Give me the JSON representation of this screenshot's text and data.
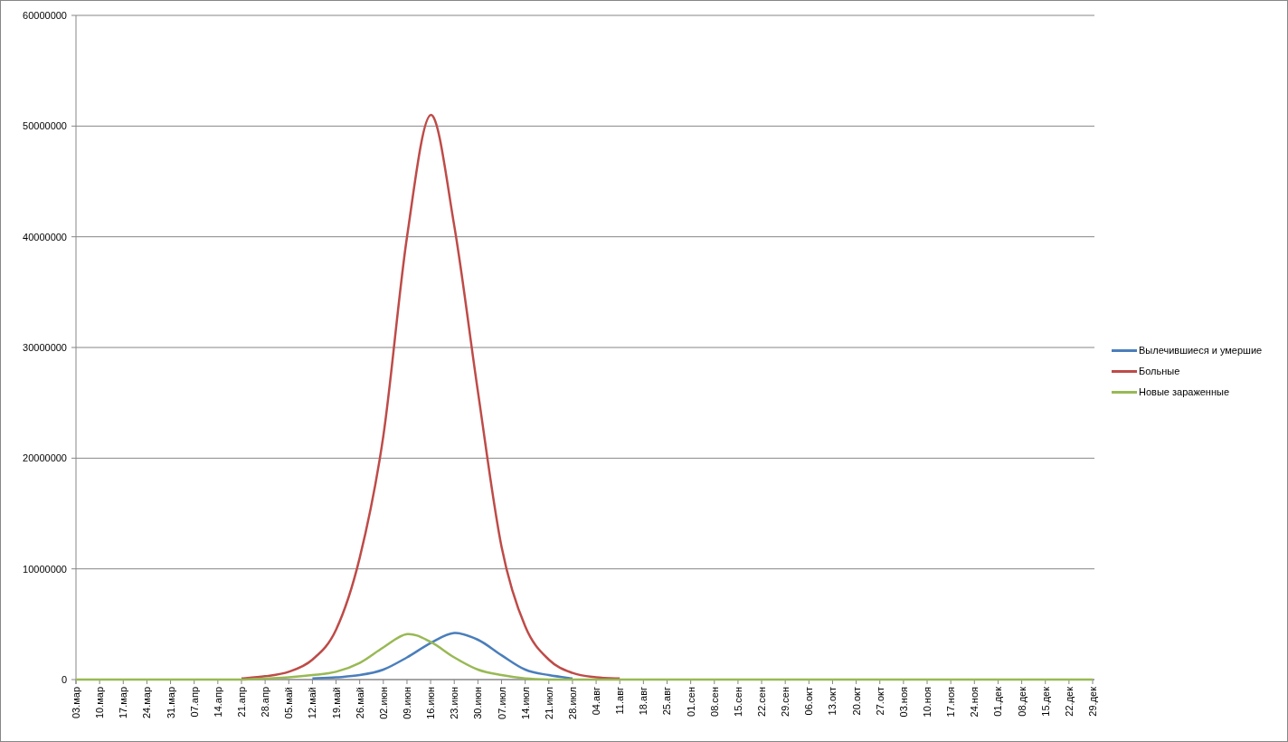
{
  "chart_data": {
    "type": "line",
    "grid": true,
    "categories": [
      "03.мар",
      "10.мар",
      "17.мар",
      "24.мар",
      "31.мар",
      "07.апр",
      "14.апр",
      "21.апр",
      "28.апр",
      "05.май",
      "12.май",
      "19.май",
      "26.май",
      "02.июн",
      "09.июн",
      "16.июн",
      "23.июн",
      "30.июн",
      "07.июл",
      "14.июл",
      "21.июл",
      "28.июл",
      "04.авг",
      "11.авг",
      "18.авг",
      "25.авг",
      "01.сен",
      "08.сен",
      "15.сен",
      "22.сен",
      "29.сен",
      "06.окт",
      "13.окт",
      "20.окт",
      "27.окт",
      "03.ноя",
      "10.ноя",
      "17.ноя",
      "24.ноя",
      "01.дек",
      "08.дек",
      "15.дек",
      "22.дек",
      "29.дек"
    ],
    "ylim": [
      0,
      60000000
    ],
    "yticks": [
      0,
      10000000,
      20000000,
      30000000,
      40000000,
      50000000,
      60000000
    ],
    "series": [
      {
        "name": "Вылечившиеся и умершие",
        "color": "#4a7ebb",
        "values": [
          null,
          null,
          null,
          null,
          null,
          null,
          null,
          null,
          null,
          null,
          100000,
          200000,
          400000,
          900000,
          2000000,
          3300000,
          4200000,
          3600000,
          2200000,
          900000,
          400000,
          100000,
          null,
          null,
          null,
          null,
          null,
          null,
          null,
          null,
          null,
          null,
          null,
          null,
          null,
          null,
          null,
          null,
          null,
          null,
          null,
          null,
          null,
          null
        ]
      },
      {
        "name": "Больные",
        "color": "#be4b48",
        "values": [
          null,
          null,
          null,
          null,
          null,
          null,
          null,
          100000,
          300000,
          700000,
          1800000,
          4500000,
          11000000,
          22000000,
          40000000,
          51000000,
          41000000,
          26000000,
          12000000,
          4800000,
          1800000,
          600000,
          200000,
          100000,
          null,
          null,
          null,
          null,
          null,
          null,
          null,
          null,
          null,
          null,
          null,
          null,
          null,
          null,
          null,
          null,
          null,
          null,
          null,
          null
        ]
      },
      {
        "name": "Новые зараженные",
        "color": "#98b954",
        "values": [
          0,
          0,
          0,
          0,
          0,
          0,
          0,
          0,
          100000,
          200000,
          400000,
          700000,
          1500000,
          2900000,
          4100000,
          3400000,
          2000000,
          900000,
          400000,
          100000,
          0,
          0,
          0,
          0,
          0,
          0,
          0,
          0,
          0,
          0,
          0,
          0,
          0,
          0,
          0,
          0,
          0,
          0,
          0,
          0,
          0,
          0,
          0,
          0
        ]
      }
    ]
  }
}
